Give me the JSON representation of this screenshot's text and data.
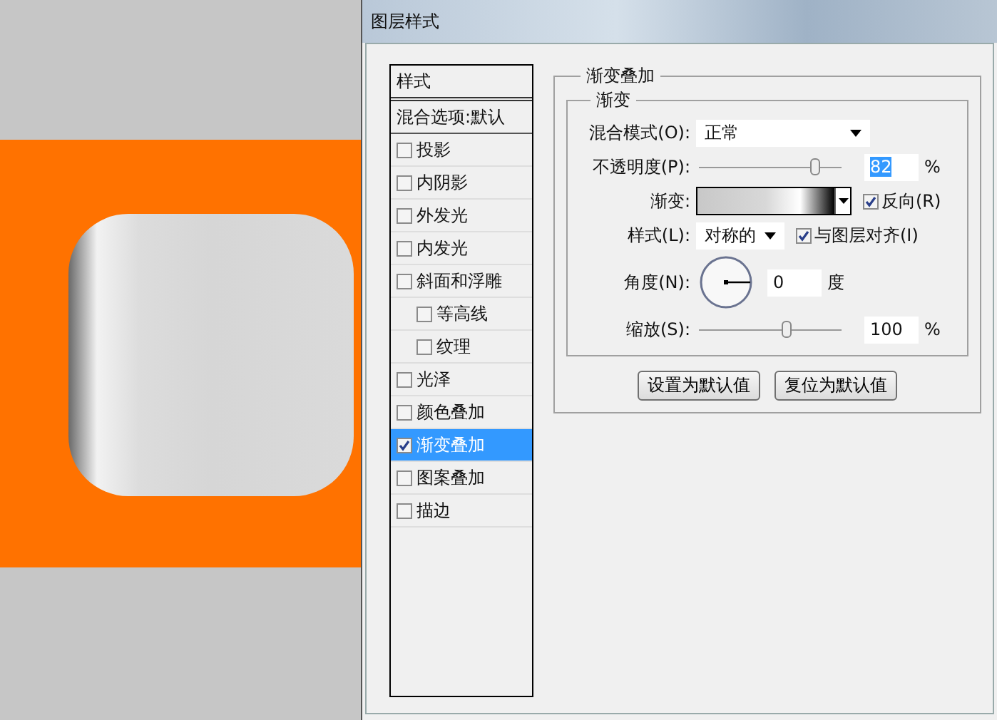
{
  "window": {
    "title": "图层样式"
  },
  "sidebar": {
    "header": "样式",
    "blend_options": "混合选项:默认",
    "items": [
      {
        "label": "投影",
        "checked": false,
        "selected": false
      },
      {
        "label": "内阴影",
        "checked": false,
        "selected": false
      },
      {
        "label": "外发光",
        "checked": false,
        "selected": false
      },
      {
        "label": "内发光",
        "checked": false,
        "selected": false
      },
      {
        "label": "斜面和浮雕",
        "checked": false,
        "selected": false,
        "children": [
          {
            "label": "等高线",
            "checked": false,
            "selected": false
          },
          {
            "label": "纹理",
            "checked": false,
            "selected": false
          }
        ]
      },
      {
        "label": "光泽",
        "checked": false,
        "selected": false
      },
      {
        "label": "颜色叠加",
        "checked": false,
        "selected": false
      },
      {
        "label": "渐变叠加",
        "checked": true,
        "selected": true
      },
      {
        "label": "图案叠加",
        "checked": false,
        "selected": false
      },
      {
        "label": "描边",
        "checked": false,
        "selected": false
      }
    ]
  },
  "panel": {
    "title": "渐变叠加",
    "group_title": "渐变",
    "blend_mode": {
      "label": "混合模式(O):",
      "value": "正常"
    },
    "opacity": {
      "label": "不透明度(P):",
      "level": 0.82,
      "value": "82",
      "highlighted": true,
      "unit": "%"
    },
    "gradient": {
      "label": "渐变:"
    },
    "reverse": {
      "label": "反向(R)",
      "checked": true
    },
    "style": {
      "label": "样式(L):",
      "value": "对称的"
    },
    "align": {
      "label": "与图层对齐(I)",
      "checked": true
    },
    "angle": {
      "label": "角度(N):",
      "value": "0",
      "unit": "度"
    },
    "scale": {
      "label": "缩放(S):",
      "level": 0.62,
      "value": "100",
      "unit": "%"
    },
    "buttons": [
      "设置为默认值",
      "复位为默认值"
    ]
  }
}
